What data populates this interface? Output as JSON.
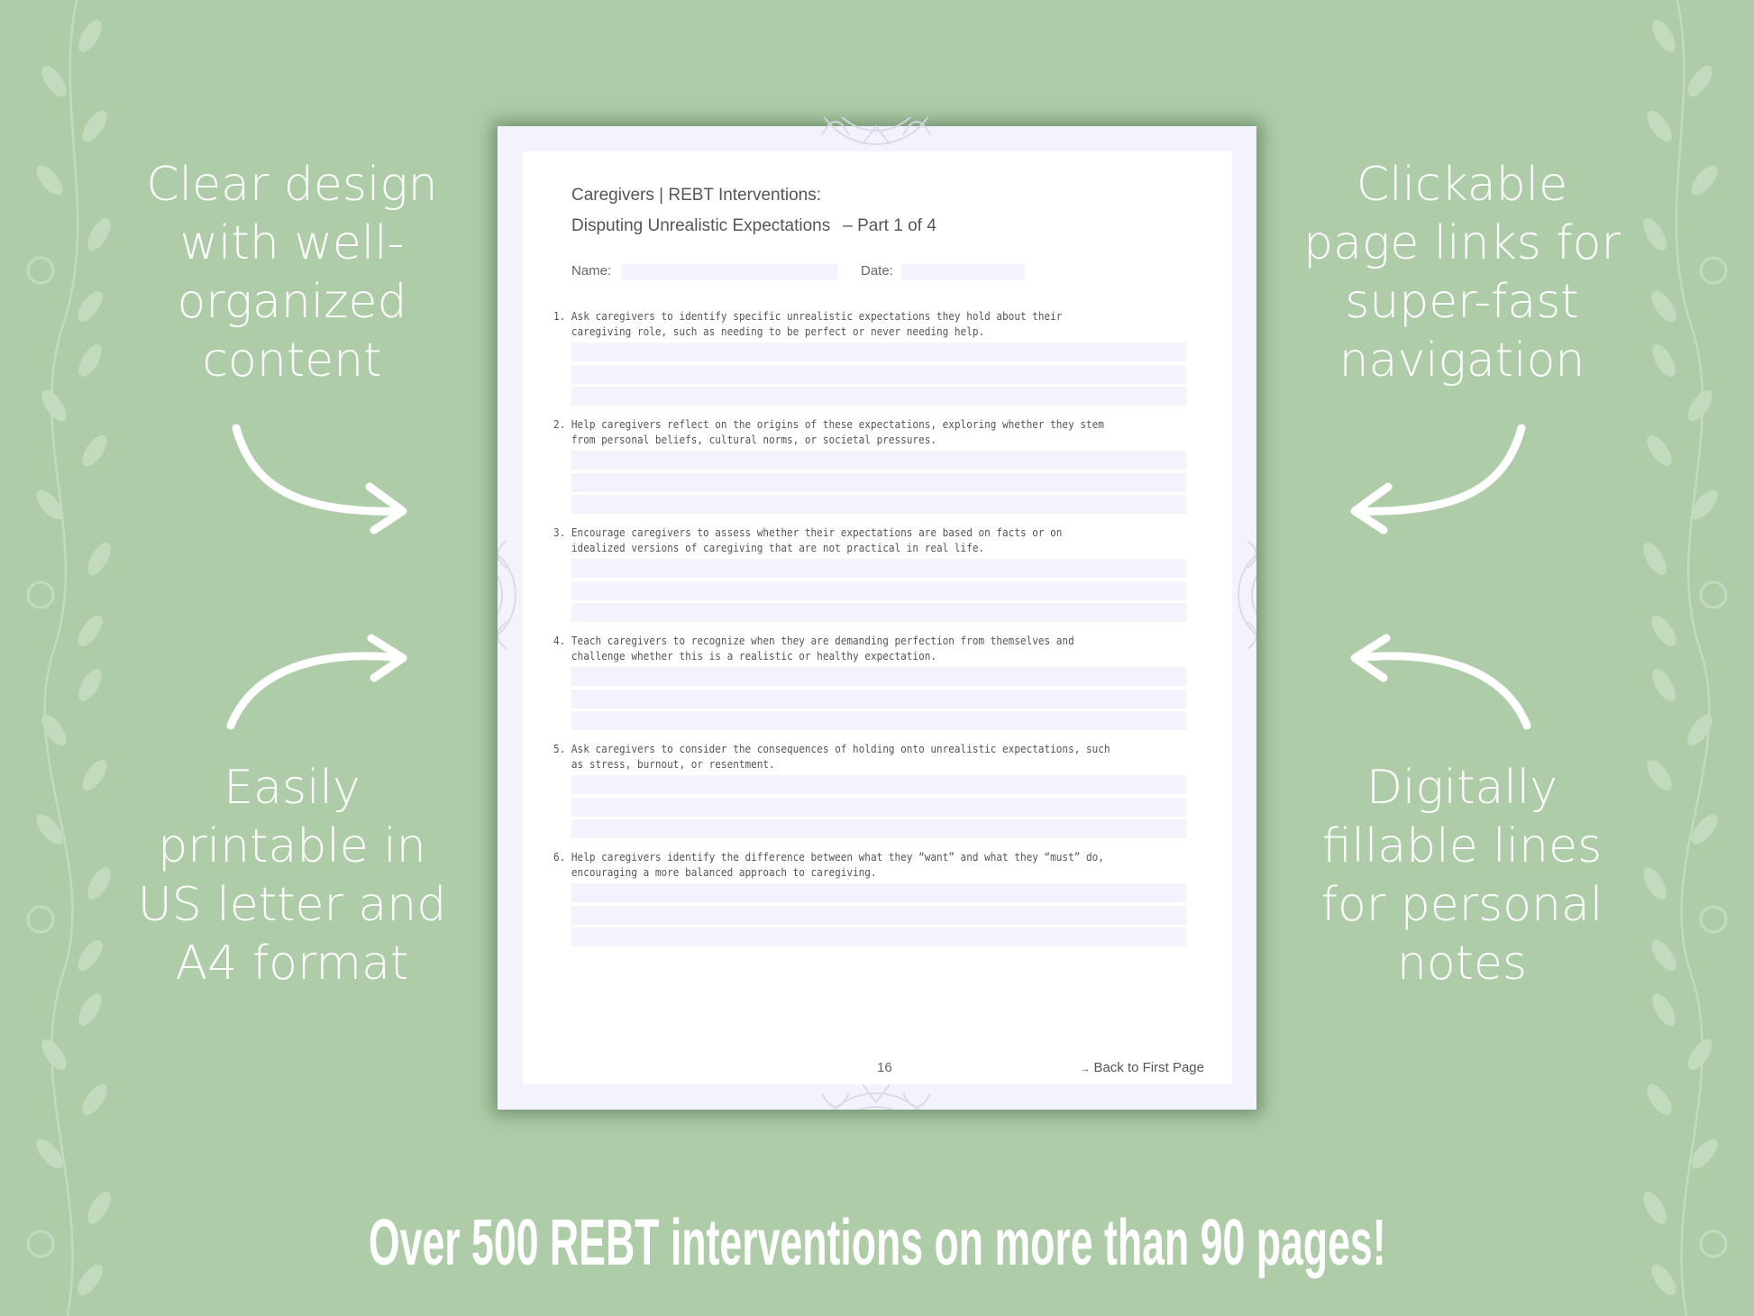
{
  "background": {
    "color": "#aecca8",
    "decoration": "floral-vine"
  },
  "features": {
    "top_left": {
      "lines": [
        "Clear design",
        "with well-",
        "organized",
        "content"
      ],
      "arrow": "curved-arrow-right-down"
    },
    "bottom_left": {
      "lines": [
        "Easily",
        "printable in",
        "US letter and",
        "A4 format"
      ],
      "arrow": "curved-arrow-right-up"
    },
    "top_right": {
      "lines": [
        "Clickable",
        "page links for",
        "super-fast",
        "navigation"
      ],
      "arrow": "curved-arrow-left-down"
    },
    "bottom_right": {
      "lines": [
        "Digitally",
        "fillable lines",
        "for personal",
        "notes"
      ],
      "arrow": "curved-arrow-left-up"
    }
  },
  "document": {
    "title": "Caregivers | REBT Interventions:",
    "subtitle": "Disputing Unrealistic Expectations",
    "part": "– Part 1 of 4",
    "name_label": "Name:",
    "name_value": "",
    "date_label": "Date:",
    "date_value": "",
    "items": [
      {
        "number": "1.",
        "lines": [
          "Ask caregivers to identify specific unrealistic expectations they hold about their",
          "caregiving role, such as needing to be perfect or never needing help."
        ],
        "answer_lines": [
          "",
          "",
          ""
        ]
      },
      {
        "number": "2.",
        "lines": [
          "Help caregivers reflect on the origins of these expectations, exploring whether they stem",
          "from personal beliefs, cultural norms, or societal pressures."
        ],
        "answer_lines": [
          "",
          "",
          ""
        ]
      },
      {
        "number": "3.",
        "lines": [
          "Encourage caregivers to assess whether their expectations are based on facts or on",
          "idealized versions of caregiving that are not practical in real life."
        ],
        "answer_lines": [
          "",
          "",
          ""
        ]
      },
      {
        "number": "4.",
        "lines": [
          "Teach caregivers to recognize when they are demanding perfection from themselves and",
          "challenge whether this is a realistic or healthy expectation."
        ],
        "answer_lines": [
          "",
          "",
          ""
        ]
      },
      {
        "number": "5.",
        "lines": [
          "Ask caregivers to consider the consequences of holding onto unrealistic expectations, such",
          "as stress, burnout, or resentment."
        ],
        "answer_lines": [
          "",
          "",
          ""
        ]
      },
      {
        "number": "6.",
        "lines": [
          "Help caregivers identify the difference between what they “want” and what they “must” do,",
          "encouraging a more balanced approach to caregiving."
        ],
        "answer_lines": [
          "",
          "",
          ""
        ]
      }
    ],
    "page_number": "16",
    "back_link_icon": "arrow-right-icon",
    "back_link_glyph": "→",
    "back_link_label": "Back to First Page",
    "accent_color": "#f4f2fd"
  },
  "banner": {
    "text": "Over 500 REBT interventions on more than 90 pages!"
  }
}
